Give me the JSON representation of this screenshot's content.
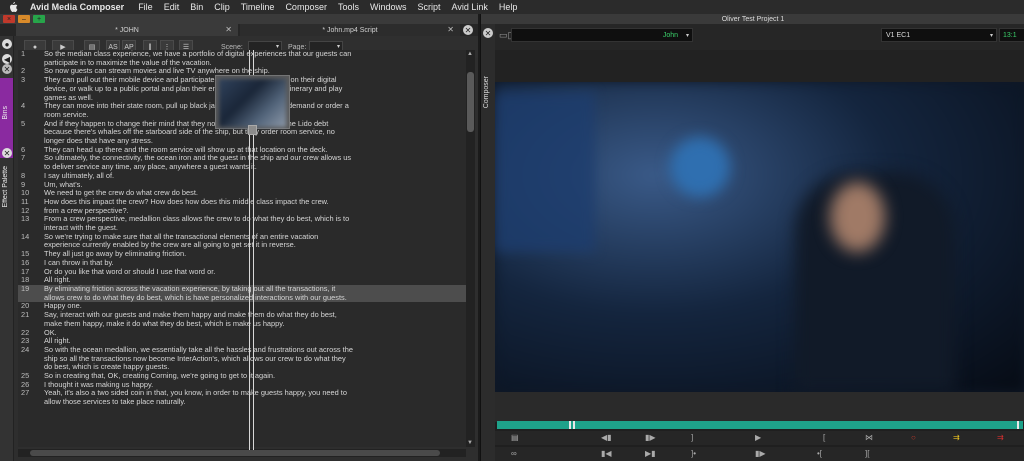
{
  "menubar": {
    "app_name": "Avid Media Composer",
    "items": [
      "File",
      "Edit",
      "Bin",
      "Clip",
      "Timeline",
      "Composer",
      "Tools",
      "Windows",
      "Script",
      "Avid Link",
      "Help"
    ]
  },
  "left_window": {
    "tabs": [
      {
        "label": "* JOHN"
      },
      {
        "label": "* John.mp4 Script"
      }
    ],
    "side_labels": {
      "bins": "Bins",
      "effect_palette": "Effect Palette"
    },
    "toolbar": {
      "as_label": "AS",
      "ap_label": "AP",
      "scene_label": "Scene:",
      "page_label": "Page:"
    },
    "script_lines": [
      {
        "num": "1",
        "text": "So the median class experience, we have a portfolio of digital experiences that our guests can participate in to maximize the value of the vacation."
      },
      {
        "num": "2",
        "text": "So now guests can stream movies and live TV anywhere on the ship."
      },
      {
        "num": "3",
        "text": "They can pull out their mobile device and participate in a slot machine right on their digital device, or walk up to a public portal and plan their entire journey and their itinerary and play games as well."
      },
      {
        "num": "4",
        "text": "They can move into their state room, pull up black jack or order movies on demand or order a room service."
      },
      {
        "num": "5",
        "text": "And if they happen to change their mind that they now want to head up to the Lido debt because there's whales off the starboard side of the ship, but they order room service, no longer does that have any stress."
      },
      {
        "num": "6",
        "text": "They can head up there and the room service will show up at that location on the deck."
      },
      {
        "num": "7",
        "text": "So ultimately, the connectivity, the ocean iron and the guest in the ship and our crew allows us to deliver service any time, any place, anywhere a guest wants it."
      },
      {
        "num": "8",
        "text": "I say ultimately, all of."
      },
      {
        "num": "9",
        "text": "Um, what's."
      },
      {
        "num": "10",
        "text": "We need to get the crew do what crew do best."
      },
      {
        "num": "11",
        "text": "How does this impact the crew? How does how does this middle class impact the crew."
      },
      {
        "num": "12",
        "text": "from a crew perspective?."
      },
      {
        "num": "13",
        "text": "From a crew perspective, medallion class allows the crew to do what they do best, which is to interact with the guest."
      },
      {
        "num": "14",
        "text": "So we're trying to make sure that all the transactional elements of an entire vacation experience currently enabled by the crew are all going to get set it in reverse."
      },
      {
        "num": "15",
        "text": "They all just go away by eliminating friction."
      },
      {
        "num": "16",
        "text": "I can throw in that by."
      },
      {
        "num": "17",
        "text": "Or do you like that word or should I use that word or."
      },
      {
        "num": "18",
        "text": "All right."
      },
      {
        "num": "19",
        "text": "By eliminating friction across the vacation experience, by taking out all the transactions, it allows crew to do what they do best, which is have personalized interactions with our guests.",
        "selected": true
      },
      {
        "num": "20",
        "text": "Happy one."
      },
      {
        "num": "21",
        "text": "Say, interact with our guests and make them happy and make them do what they do best, make them happy, make it do what they do best, which is make us happy."
      },
      {
        "num": "22",
        "text": "OK."
      },
      {
        "num": "23",
        "text": "All right."
      },
      {
        "num": "24",
        "text": "So with the ocean medallion, we essentially take all the hassles and frustrations out across the ship so all the transactions now become InterAction's, which allows our crew to do what they do best, which is create happy guests."
      },
      {
        "num": "25",
        "text": "So in creating that, OK, creating Corning, we're going to get to it again."
      },
      {
        "num": "26",
        "text": "I thought it was making us happy."
      },
      {
        "num": "27",
        "text": "Yeah, it's also a two sided coin in that, you know, in order to make guests happy, you need to allow those services to take place naturally."
      }
    ]
  },
  "composer": {
    "window_title": "Oliver Test Project 1",
    "side_label": "Composer",
    "source_name": "John",
    "track_info": "V1  EC1",
    "timecode_partial": "13:1"
  },
  "colors": {
    "bins_accent": "#8a2aa0",
    "timeline": "#1ea28a",
    "source_name_text": "#3ad06a",
    "close_red": "#c0392b",
    "min_orange": "#d88a2a",
    "max_green": "#27a54a"
  }
}
